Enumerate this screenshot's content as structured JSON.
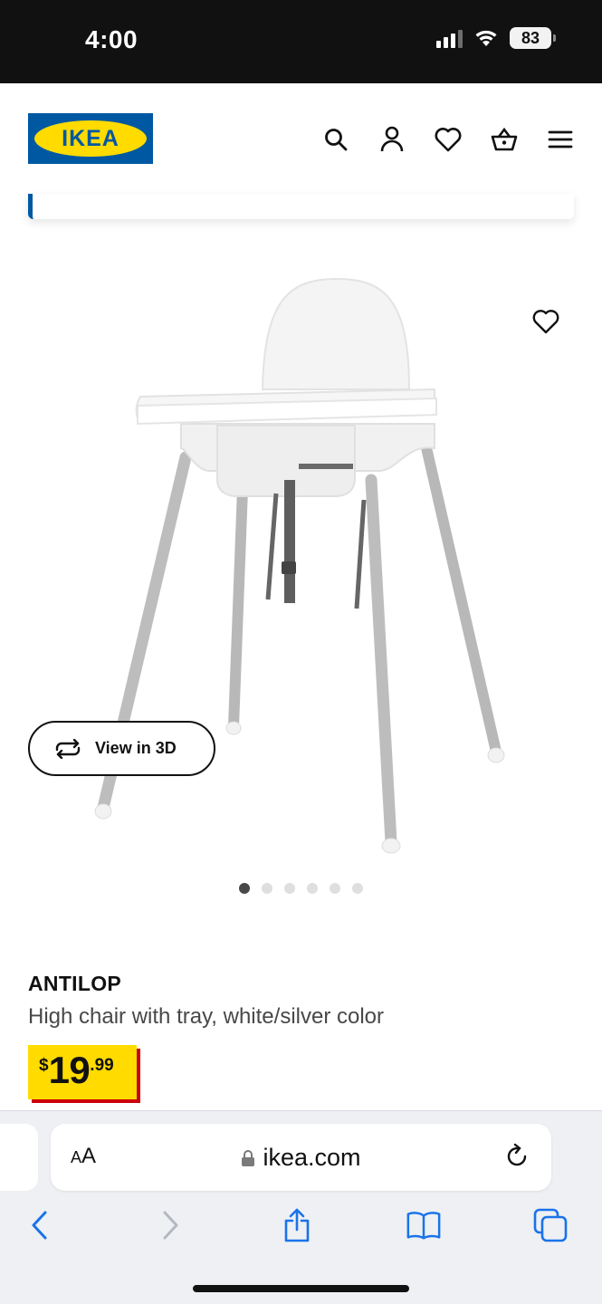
{
  "status_bar": {
    "time": "4:00",
    "battery": "83"
  },
  "header": {
    "logo_text": "IKEA"
  },
  "product": {
    "name": "ANTILOP",
    "description": "High chair with tray, white/silver color",
    "price": {
      "currency": "$",
      "main": "19",
      "cents": ".99"
    },
    "view3d_label": "View in 3D",
    "image_count": 6,
    "active_image": 1
  },
  "browser": {
    "aa_label": "A",
    "aa_label_big": "A",
    "url": "ikea.com"
  },
  "colors": {
    "ikea_blue": "#0058a3",
    "ikea_yellow": "#ffdb00",
    "price_shadow": "#cc0008",
    "safari_blue": "#1a73e8"
  }
}
